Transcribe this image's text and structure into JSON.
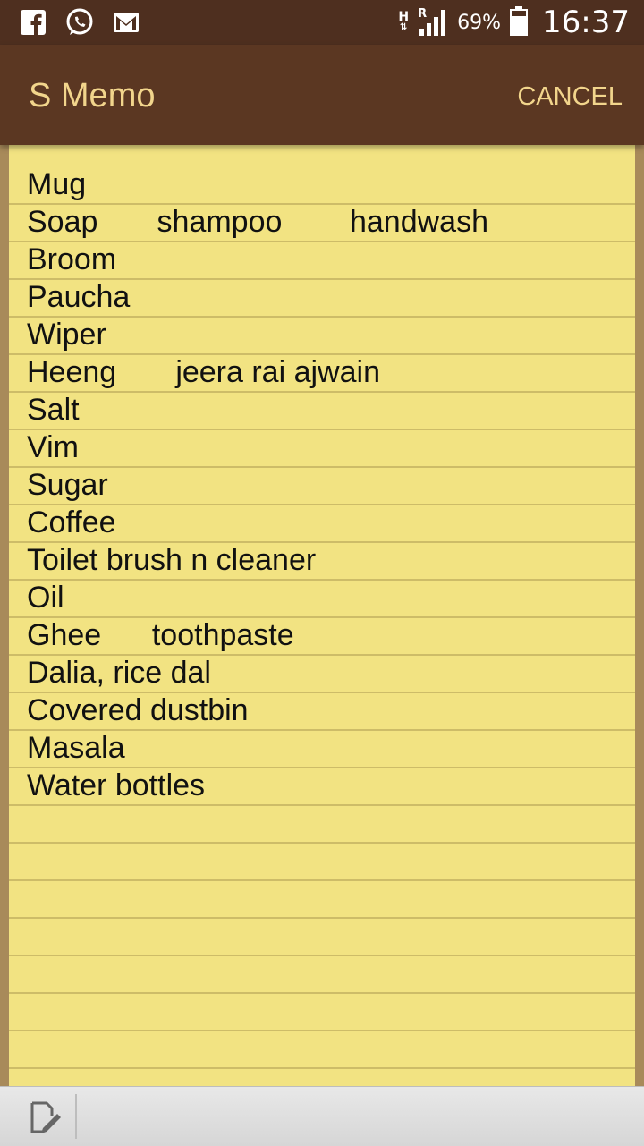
{
  "status_bar": {
    "network_type": "H",
    "roaming": "R",
    "battery_percent": "69%",
    "time": "16:37",
    "notifications": [
      "facebook-icon",
      "whatsapp-icon",
      "gmail-icon"
    ]
  },
  "app_bar": {
    "title": "S Memo",
    "cancel_label": "CANCEL"
  },
  "memo": {
    "lines": [
      "Mug",
      "Soap       shampoo        handwash",
      "Broom",
      "Paucha",
      "Wiper",
      "Heeng       jeera rai ajwain",
      "Salt",
      "Vim",
      "Sugar",
      "Coffee",
      "Toilet brush n cleaner",
      "Oil",
      "Ghee      toothpaste",
      "Dalia, rice dal",
      "Covered dustbin",
      "Masala",
      "Water bottles"
    ]
  },
  "colors": {
    "status_bar": "#4e2f1f",
    "app_bar": "#5b3722",
    "accent_text": "#f2d58c",
    "paper": "#f2e382",
    "rule_line": "#cdbc68"
  }
}
